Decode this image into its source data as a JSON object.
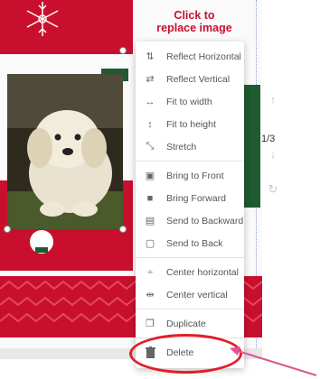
{
  "overlay_text": {
    "line1": "Click to",
    "line2": "replace image"
  },
  "page_indicator": "1/3",
  "context_menu": {
    "items": [
      {
        "label": "Reflect Horizontal",
        "icon": "reflect-horizontal-icon",
        "glyph": "⇅"
      },
      {
        "label": "Reflect Vertical",
        "icon": "reflect-vertical-icon",
        "glyph": "⇄"
      },
      {
        "label": "Fit to width",
        "icon": "fit-width-icon",
        "glyph": "↔"
      },
      {
        "label": "Fit to height",
        "icon": "fit-height-icon",
        "glyph": "↕"
      },
      {
        "label": "Stretch",
        "icon": "stretch-icon",
        "glyph": "⤡"
      },
      {
        "label": "Bring to Front",
        "icon": "bring-front-icon",
        "glyph": "▣"
      },
      {
        "label": "Bring Forward",
        "icon": "bring-forward-icon",
        "glyph": "■"
      },
      {
        "label": "Send to Backward",
        "icon": "send-backward-icon",
        "glyph": "▤"
      },
      {
        "label": "Send to Back",
        "icon": "send-back-icon",
        "glyph": "▢"
      },
      {
        "label": "Center horizontal",
        "icon": "center-horizontal-icon",
        "glyph": "÷"
      },
      {
        "label": "Center vertical",
        "icon": "center-vertical-icon",
        "glyph": "⇹"
      },
      {
        "label": "Duplicate",
        "icon": "duplicate-icon",
        "glyph": "❐"
      },
      {
        "label": "Delete",
        "icon": "trash-icon",
        "glyph": "🗑"
      }
    ]
  },
  "colors": {
    "accent_red": "#c8102e",
    "green": "#1e5a32",
    "highlight": "#e01f2a",
    "arrow": "#e0568f"
  }
}
